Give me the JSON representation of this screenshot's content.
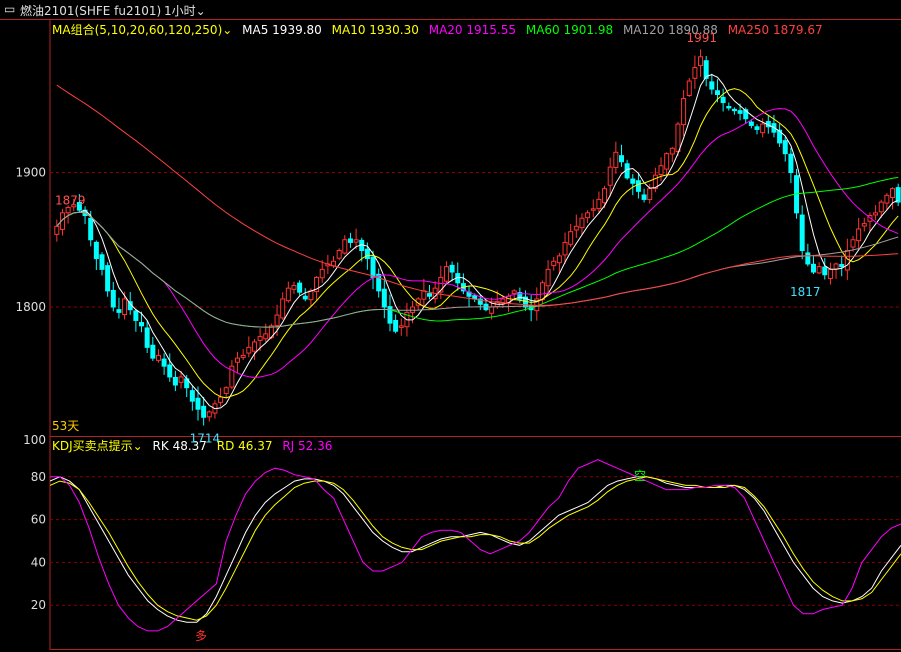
{
  "header": {
    "window_icon": "window-toggle-icon",
    "instrument": "燃油2101(SHFE fu2101)",
    "period": "1小时",
    "period_icon": "chevron-down-icon"
  },
  "main_legend": {
    "indicator": "MA组合(5,10,20,60,120,250)",
    "items": [
      {
        "text": "MA5 1939.80",
        "color": "#ffffff"
      },
      {
        "text": "MA10 1930.30",
        "color": "#ffff00"
      },
      {
        "text": "MA20 1915.55",
        "color": "#ff00ff"
      },
      {
        "text": "MA60 1901.98",
        "color": "#00ff00"
      },
      {
        "text": "MA120 1890.88",
        "color": "#a0a0a0"
      },
      {
        "text": "MA250 1879.67",
        "color": "#ff4040"
      }
    ]
  },
  "kdj_legend": {
    "indicator": "KDJ买卖点提示",
    "items": [
      {
        "text": "RK 48.37",
        "color": "#ffffff"
      },
      {
        "text": "RD 46.37",
        "color": "#ffff00"
      },
      {
        "text": "RJ 52.36",
        "color": "#ff00ff"
      }
    ]
  },
  "annotations": {
    "high_label": "1991",
    "low_label": "1714",
    "left_high_label": "1879",
    "recent_low_label": "1817",
    "days_label": "53天",
    "sell_mark": "空",
    "buy_mark": "多"
  },
  "colors": {
    "up": "#ff3333",
    "down": "#00ffff",
    "grid": "#8b0000",
    "axis": "#b22222"
  },
  "chart_data": [
    {
      "type": "candlestick",
      "title": "燃油2101(SHFE fu2101) 1小时",
      "y_ticks": [
        1800,
        1900
      ],
      "ylim": [
        1705,
        2000
      ],
      "grid": true,
      "close": [
        1860,
        1870,
        1874,
        1876,
        1872,
        1868,
        1850,
        1836,
        1828,
        1812,
        1800,
        1796,
        1806,
        1798,
        1790,
        1786,
        1770,
        1762,
        1764,
        1756,
        1748,
        1742,
        1748,
        1740,
        1730,
        1724,
        1718,
        1722,
        1728,
        1733,
        1740,
        1756,
        1762,
        1764,
        1770,
        1774,
        1778,
        1780,
        1786,
        1794,
        1806,
        1814,
        1816,
        1811,
        1806,
        1812,
        1822,
        1828,
        1832,
        1834,
        1842,
        1850,
        1848,
        1850,
        1842,
        1836,
        1822,
        1812,
        1800,
        1788,
        1782,
        1786,
        1796,
        1800,
        1806,
        1812,
        1808,
        1814,
        1822,
        1830,
        1826,
        1818,
        1812,
        1808,
        1806,
        1802,
        1798,
        1800,
        1804,
        1806,
        1808,
        1812,
        1806,
        1800,
        1798,
        1806,
        1818,
        1828,
        1834,
        1838,
        1848,
        1856,
        1860,
        1866,
        1870,
        1873,
        1880,
        1888,
        1904,
        1915,
        1908,
        1896,
        1892,
        1886,
        1880,
        1888,
        1898,
        1905,
        1914,
        1918,
        1936,
        1955,
        1968,
        1978,
        1986,
        1970,
        1962,
        1958,
        1952,
        1948,
        1946,
        1944,
        1940,
        1935,
        1932,
        1936,
        1934,
        1930,
        1922,
        1914,
        1900,
        1870,
        1842,
        1832,
        1826,
        1830,
        1824,
        1828,
        1832,
        1830,
        1842,
        1850,
        1858,
        1862,
        1868,
        1870,
        1878,
        1883,
        1888,
        1878
      ],
      "high": 1991,
      "low": 1714
    },
    {
      "type": "line",
      "title": "KDJ买卖点提示",
      "y_ticks": [
        20,
        40,
        60,
        80,
        100
      ],
      "ylim": [
        0,
        100
      ],
      "series": [
        {
          "name": "RK",
          "values": [
            78,
            80,
            78,
            74,
            66,
            58,
            50,
            42,
            34,
            28,
            22,
            18,
            15,
            13,
            12,
            12,
            16,
            24,
            34,
            44,
            54,
            62,
            68,
            72,
            75,
            78,
            79,
            79,
            78,
            76,
            72,
            66,
            60,
            54,
            50,
            47,
            45,
            45,
            47,
            49,
            51,
            52,
            52,
            53,
            54,
            53,
            51,
            49,
            48,
            50,
            54,
            58,
            62,
            64,
            66,
            68,
            72,
            76,
            78,
            79,
            80,
            80,
            79,
            77,
            76,
            75,
            75,
            75,
            75,
            76,
            76,
            74,
            70,
            64,
            56,
            48,
            40,
            34,
            28,
            24,
            22,
            21,
            22,
            24,
            28,
            36,
            42,
            48
          ]
        },
        {
          "name": "RD",
          "values": [
            76,
            78,
            77,
            74,
            68,
            61,
            54,
            46,
            38,
            31,
            25,
            20,
            17,
            15,
            14,
            13,
            15,
            20,
            28,
            37,
            46,
            55,
            62,
            67,
            71,
            75,
            77,
            78,
            78,
            77,
            74,
            69,
            63,
            57,
            52,
            49,
            47,
            46,
            46,
            48,
            50,
            51,
            52,
            52,
            53,
            53,
            52,
            50,
            49,
            49,
            52,
            56,
            59,
            62,
            64,
            66,
            69,
            73,
            76,
            78,
            79,
            80,
            79,
            78,
            77,
            76,
            76,
            75,
            75,
            75,
            76,
            75,
            71,
            66,
            59,
            52,
            44,
            37,
            31,
            27,
            24,
            22,
            22,
            23,
            26,
            32,
            38,
            44
          ]
        },
        {
          "name": "RJ",
          "values": [
            80,
            80,
            76,
            68,
            56,
            42,
            30,
            20,
            14,
            10,
            8,
            8,
            10,
            14,
            18,
            22,
            26,
            30,
            50,
            62,
            72,
            78,
            82,
            84,
            83,
            81,
            80,
            79,
            74,
            70,
            60,
            50,
            40,
            36,
            36,
            38,
            40,
            46,
            52,
            54,
            55,
            55,
            54,
            50,
            46,
            44,
            46,
            48,
            50,
            54,
            60,
            66,
            70,
            78,
            84,
            86,
            88,
            86,
            84,
            82,
            80,
            78,
            76,
            74,
            74,
            74,
            75,
            75,
            76,
            76,
            75,
            70,
            60,
            50,
            40,
            30,
            20,
            16,
            16,
            18,
            19,
            20,
            28,
            40,
            46,
            52,
            56,
            58
          ]
        }
      ]
    }
  ]
}
